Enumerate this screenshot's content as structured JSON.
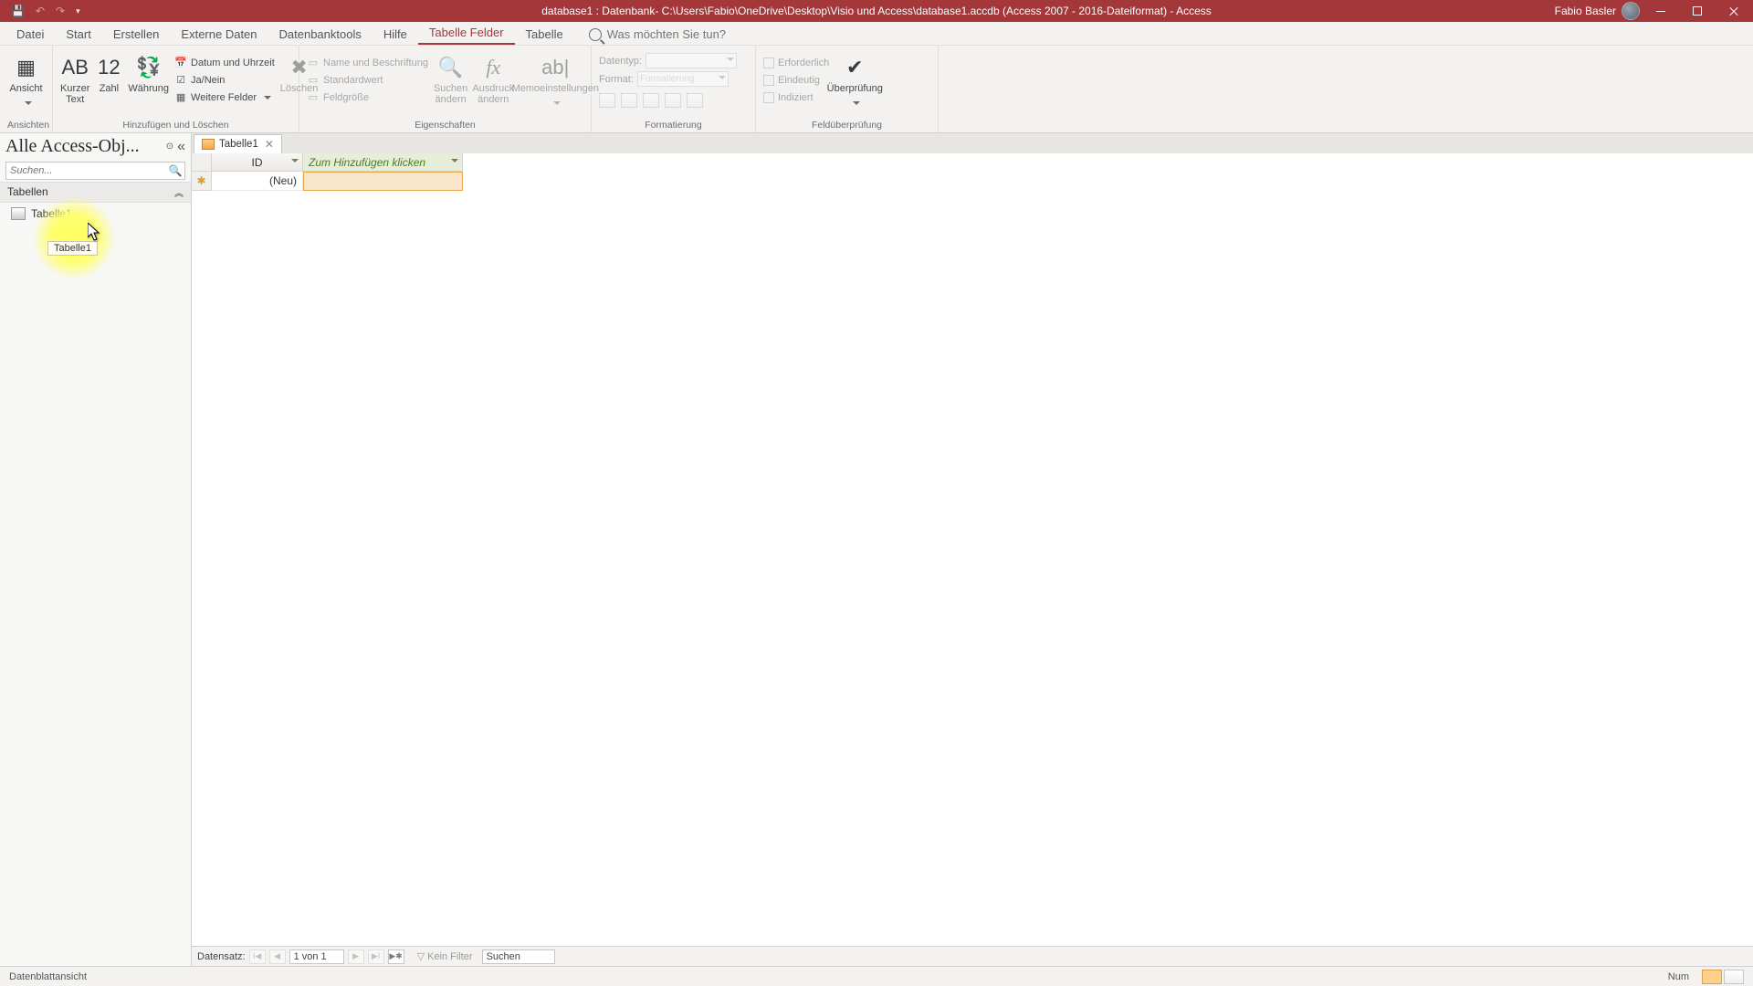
{
  "titlebar": {
    "title": "database1 : Datenbank- C:\\Users\\Fabio\\OneDrive\\Desktop\\Visio und Access\\database1.accdb (Access 2007 - 2016-Dateiformat) - Access",
    "user": "Fabio Basler"
  },
  "tabs": {
    "datei": "Datei",
    "start": "Start",
    "erstellen": "Erstellen",
    "externe_daten": "Externe Daten",
    "datenbanktools": "Datenbanktools",
    "hilfe": "Hilfe",
    "tabelle_felder": "Tabelle Felder",
    "tabelle": "Tabelle",
    "tell_me_placeholder": "Was möchten Sie tun?"
  },
  "ribbon": {
    "ansichten": {
      "label": "Ansichten",
      "ansicht": "Ansicht"
    },
    "hinzufuegen": {
      "label": "Hinzufügen und Löschen",
      "kurzer_text": "Kurzer\nText",
      "zahl": "Zahl",
      "waehrung": "Währung",
      "datum": "Datum und Uhrzeit",
      "janein": "Ja/Nein",
      "weitere": "Weitere Felder",
      "loeschen": "Löschen"
    },
    "eigenschaften": {
      "label": "Eigenschaften",
      "name": "Name und Beschriftung",
      "standard": "Standardwert",
      "feldgroesse": "Feldgröße",
      "suchen": "Suchen\nändern",
      "ausdruck": "Ausdruck\nändern",
      "memo": "Memoeinstellungen"
    },
    "formatierung": {
      "label": "Formatierung",
      "datentyp": "Datentyp:",
      "format": "Format:",
      "format_placeholder": "Formatierung"
    },
    "feldpruef": {
      "label": "Feldüberprüfung",
      "erforderlich": "Erforderlich",
      "eindeutig": "Eindeutig",
      "indiziert": "Indiziert",
      "ueberpruefung": "Überprüfung"
    }
  },
  "navpane": {
    "title": "Alle Access-Obj...",
    "search_placeholder": "Suchen...",
    "group": "Tabellen",
    "item": "Tabelle1",
    "tooltip": "Tabelle1"
  },
  "doc": {
    "tab": "Tabelle1",
    "col_id": "ID",
    "col_add": "Zum Hinzufügen klicken",
    "new_row": "(Neu)"
  },
  "recordnav": {
    "label": "Datensatz:",
    "pos": "1 von 1",
    "no_filter": "Kein Filter",
    "search": "Suchen"
  },
  "status": {
    "view": "Datenblattansicht",
    "num": "Num"
  }
}
